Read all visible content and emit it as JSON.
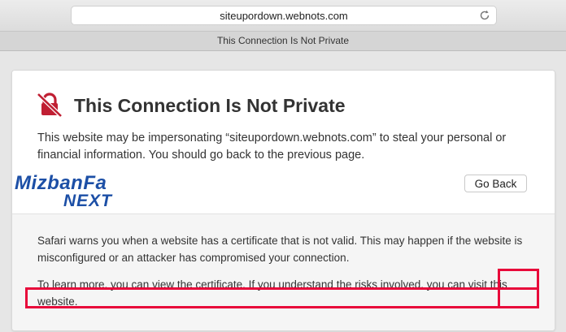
{
  "browser": {
    "address": "siteupordown.webnots.com",
    "tab_title": "This Connection Is Not Private",
    "reload_icon": "reload-icon"
  },
  "warning": {
    "icon": "broken-lock-icon",
    "icon_color": "#c01f33",
    "title": "This Connection Is Not Private",
    "intro": "This website may be impersonating “siteupordown.webnots.com” to steal your personal or financial information. You should go back to the previous page.",
    "go_back_label": "Go Back",
    "details_p1": "Safari warns you when a website has a certificate that is not valid. This may happen if the website is misconfigured or an attacker has compromised your connection.",
    "details_p2_prefix": "To learn more, you can view the certificate. If you understand the risks involved, you can ",
    "visit_link": "visit this website",
    "details_p2_suffix": "."
  },
  "annotation": {
    "highlight_color": "#e8083a"
  },
  "watermark": {
    "line1": "MizbanFa",
    "line2": "NEXT",
    "color": "#1c4fa6"
  }
}
